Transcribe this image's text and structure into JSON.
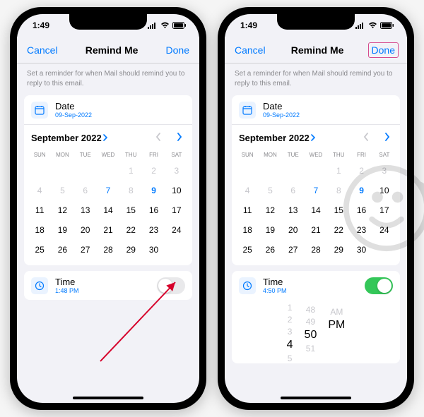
{
  "statusbar": {
    "time": "1:49"
  },
  "nav": {
    "cancel": "Cancel",
    "title": "Remind Me",
    "done": "Done"
  },
  "subtitle": "Set a reminder for when Mail should remind you to reply to this email.",
  "date": {
    "label": "Date",
    "value": "09-Sep-2022"
  },
  "month": {
    "title": "September 2022"
  },
  "weekdays": [
    "SUN",
    "MON",
    "TUE",
    "WED",
    "THU",
    "FRI",
    "SAT"
  ],
  "weeks": [
    {
      "cells": [
        {
          "v": "",
          "cls": ""
        },
        {
          "v": "",
          "cls": ""
        },
        {
          "v": "",
          "cls": ""
        },
        {
          "v": "",
          "cls": ""
        },
        {
          "v": "1",
          "cls": "dim"
        },
        {
          "v": "2",
          "cls": "dim"
        },
        {
          "v": "3",
          "cls": "dim"
        }
      ]
    },
    {
      "cells": [
        {
          "v": "4",
          "cls": "dim"
        },
        {
          "v": "5",
          "cls": "dim"
        },
        {
          "v": "6",
          "cls": "dim"
        },
        {
          "v": "7",
          "cls": "today"
        },
        {
          "v": "8",
          "cls": "dim"
        },
        {
          "v": "9",
          "cls": "selected"
        },
        {
          "v": "10",
          "cls": ""
        }
      ]
    },
    {
      "cells": [
        {
          "v": "11",
          "cls": ""
        },
        {
          "v": "12",
          "cls": ""
        },
        {
          "v": "13",
          "cls": ""
        },
        {
          "v": "14",
          "cls": ""
        },
        {
          "v": "15",
          "cls": ""
        },
        {
          "v": "16",
          "cls": ""
        },
        {
          "v": "17",
          "cls": ""
        }
      ]
    },
    {
      "cells": [
        {
          "v": "18",
          "cls": ""
        },
        {
          "v": "19",
          "cls": ""
        },
        {
          "v": "20",
          "cls": ""
        },
        {
          "v": "21",
          "cls": ""
        },
        {
          "v": "22",
          "cls": ""
        },
        {
          "v": "23",
          "cls": ""
        },
        {
          "v": "24",
          "cls": ""
        }
      ]
    },
    {
      "cells": [
        {
          "v": "25",
          "cls": ""
        },
        {
          "v": "26",
          "cls": ""
        },
        {
          "v": "27",
          "cls": ""
        },
        {
          "v": "28",
          "cls": ""
        },
        {
          "v": "29",
          "cls": ""
        },
        {
          "v": "30",
          "cls": ""
        },
        {
          "v": "",
          "cls": ""
        }
      ]
    }
  ],
  "time_left": {
    "label": "Time",
    "value": "1:48 PM"
  },
  "time_right": {
    "label": "Time",
    "value": "4:50 PM"
  },
  "picker": {
    "hours": [
      "1",
      "2",
      "3",
      "4",
      "5"
    ],
    "hour_sel_idx": 3,
    "mins": [
      "",
      "48",
      "49",
      "50",
      "51"
    ],
    "min_sel_idx": 3,
    "ampm": [
      "",
      "",
      "AM",
      "PM",
      ""
    ],
    "ampm_sel_idx": 3
  }
}
